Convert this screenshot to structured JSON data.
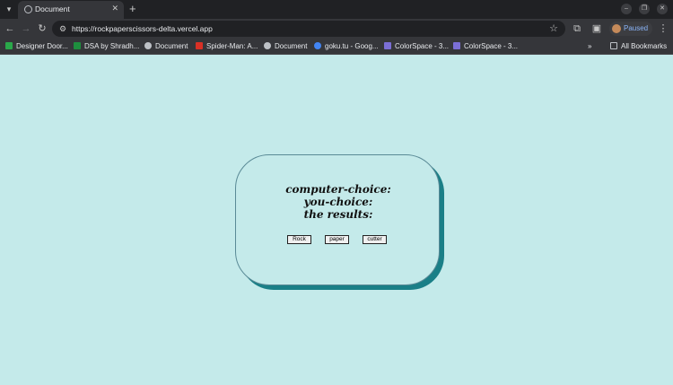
{
  "tab": {
    "title": "Document"
  },
  "toolbar": {
    "url": "https://rockpaperscissors-delta.vercel.app",
    "profile_status": "Paused"
  },
  "bookmarks": {
    "items": [
      {
        "label": "Designer Door...",
        "color": "#2aa84a"
      },
      {
        "label": "DSA by Shradh...",
        "color": "#1e8e3e"
      },
      {
        "label": "Document",
        "color": "#bdc1c6"
      },
      {
        "label": "Spider-Man: A...",
        "color": "#d93025"
      },
      {
        "label": "Document",
        "color": "#bdc1c6"
      },
      {
        "label": "goku.tu - Goog...",
        "color": "#4285f4"
      },
      {
        "label": "ColorSpace - 3...",
        "color": "#7b6fd6"
      },
      {
        "label": "ColorSpace - 3...",
        "color": "#7b6fd6"
      }
    ],
    "more_label": "»",
    "all_label": "All Bookmarks"
  },
  "game": {
    "computer_label": "computer-choice:",
    "you_label": "you-choice:",
    "result_label": "the results:",
    "buttons": {
      "rock": "Rock",
      "paper": "paper",
      "cutter": "cutter"
    }
  },
  "colors": {
    "page_bg": "#c4eaea",
    "card_shadow": "#1a7f87",
    "card_border": "#5a8a96"
  }
}
